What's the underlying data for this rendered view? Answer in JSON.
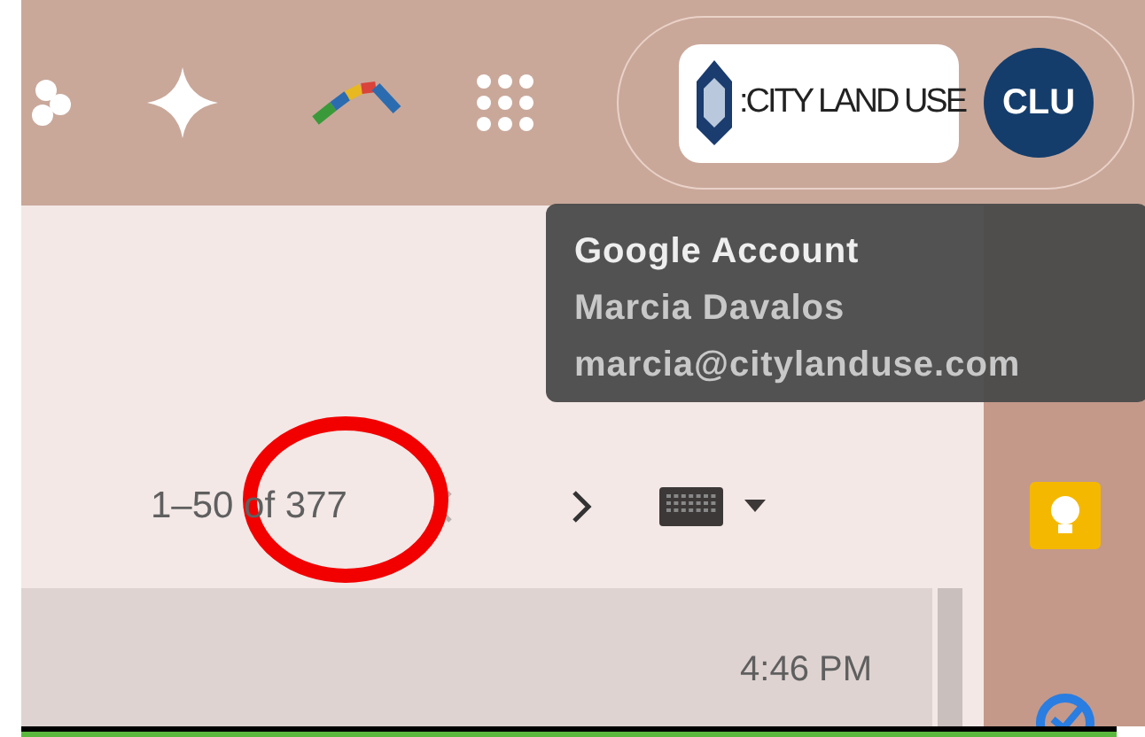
{
  "account": {
    "logo_text": ":CITY LAND USE",
    "avatar": "CLU"
  },
  "tooltip": {
    "title": "Google Account",
    "name": "Marcia Davalos",
    "email": "marcia@citylanduse.com"
  },
  "pagination": {
    "range": "1–50 of 377"
  },
  "email_row": {
    "time": "4:46 PM"
  }
}
